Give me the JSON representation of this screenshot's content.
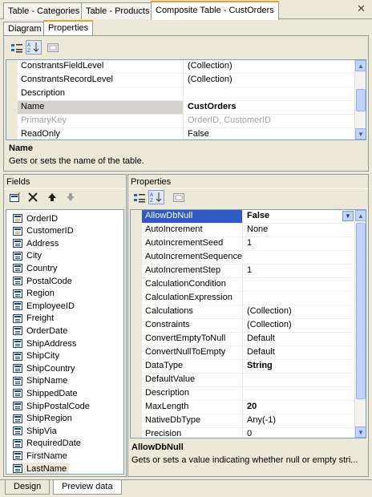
{
  "doc_tabs": [
    "Table - Categories",
    "Table - Products",
    "Composite Table - CustOrders"
  ],
  "close_glyph": "✕",
  "inner_tabs": [
    "Diagram",
    "Properties"
  ],
  "top_grid": {
    "rows": [
      {
        "name": "ConstrantsFieldLevel",
        "value": "(Collection)"
      },
      {
        "name": "ConstrantsRecordLevel",
        "value": "(Collection)"
      },
      {
        "name": "Description",
        "value": ""
      },
      {
        "name": "Name",
        "value": "CustOrders"
      },
      {
        "name": "PrimaryKey",
        "value": "OrderID, CustomerID"
      },
      {
        "name": "ReadOnly",
        "value": "False"
      }
    ],
    "description_title": "Name",
    "description_text": "Gets or sets the name of the table."
  },
  "fields_panel": {
    "header": "Fields",
    "items": [
      "OrderID",
      "CustomerID",
      "Address",
      "City",
      "Country",
      "PostalCode",
      "Region",
      "EmployeeID",
      "Freight",
      "OrderDate",
      "ShipAddress",
      "ShipCity",
      "ShipCountry",
      "ShipName",
      "ShippedDate",
      "ShipPostalCode",
      "ShipRegion",
      "ShipVia",
      "RequiredDate",
      "FirstName",
      "LastName"
    ]
  },
  "props_panel": {
    "header": "Properties",
    "rows": [
      {
        "name": "AllowDbNull",
        "value": "False"
      },
      {
        "name": "AutoIncrement",
        "value": "None"
      },
      {
        "name": "AutoIncrementSeed",
        "value": "1"
      },
      {
        "name": "AutoIncrementSequenceN",
        "value": ""
      },
      {
        "name": "AutoIncrementStep",
        "value": "1"
      },
      {
        "name": "CalculationCondition",
        "value": ""
      },
      {
        "name": "CalculationExpression",
        "value": ""
      },
      {
        "name": "Calculations",
        "value": "(Collection)"
      },
      {
        "name": "Constraints",
        "value": "(Collection)"
      },
      {
        "name": "ConvertEmptyToNull",
        "value": "Default"
      },
      {
        "name": "ConvertNullToEmpty",
        "value": "Default"
      },
      {
        "name": "DataType",
        "value": "String"
      },
      {
        "name": "DefaultValue",
        "value": ""
      },
      {
        "name": "Description",
        "value": ""
      },
      {
        "name": "MaxLength",
        "value": "20"
      },
      {
        "name": "NativeDbType",
        "value": "Any(-1)"
      },
      {
        "name": "Precision",
        "value": "0"
      }
    ],
    "description_title": "AllowDbNull",
    "description_text": "Gets or sets a value indicating whether null or empty stri..."
  },
  "bottom_tabs": [
    "Design",
    "Preview data"
  ]
}
